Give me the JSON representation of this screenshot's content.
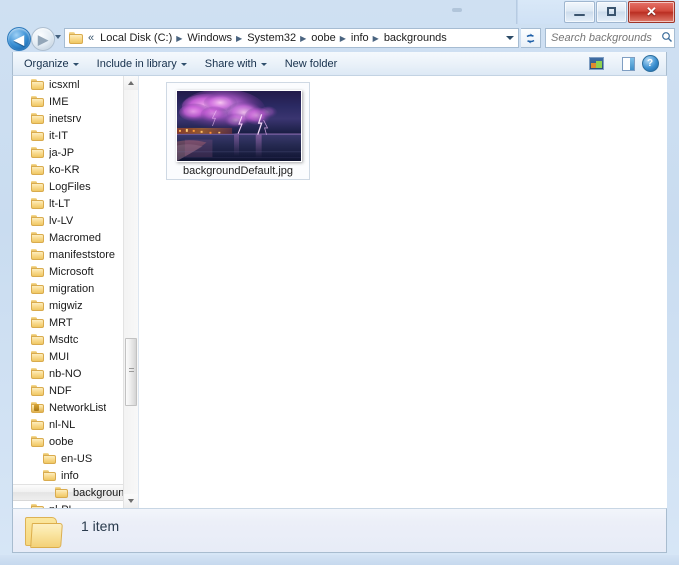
{
  "window": {
    "title": "",
    "buttons": {
      "minimize": "minimize-button",
      "maximize": "maximize-button",
      "close_glyph": "✕"
    }
  },
  "navigation": {
    "back_label": "◀",
    "forward_label": "▶",
    "recent_pages_label": "Recent pages",
    "address_ellipsis": "«",
    "breadcrumbs": [
      {
        "label": "Local Disk (C:)"
      },
      {
        "label": "Windows"
      },
      {
        "label": "System32"
      },
      {
        "label": "oobe"
      },
      {
        "label": "info"
      },
      {
        "label": "backgrounds"
      }
    ],
    "separator": "▶",
    "refresh_label": "↻",
    "search": {
      "placeholder": "Search backgrounds",
      "value": "",
      "icon": "search-icon"
    }
  },
  "toolbar": {
    "items": [
      {
        "label": "Organize",
        "has_caret": true
      },
      {
        "label": "Include in library",
        "has_caret": true
      },
      {
        "label": "Share with",
        "has_caret": true
      },
      {
        "label": "New folder",
        "has_caret": false
      }
    ],
    "right_icons": [
      {
        "name": "change-view-icon",
        "has_caret": true
      },
      {
        "name": "preview-pane-icon",
        "has_caret": false
      },
      {
        "name": "help-icon",
        "glyph": "?",
        "has_caret": false
      }
    ]
  },
  "sidebar": {
    "scrollbar": {
      "up_arrow": "scroll-up-arrow",
      "down_arrow": "scroll-down-arrow",
      "thumb": "scrollbar-thumb"
    },
    "items": [
      {
        "label": "icsxml",
        "indent": 0,
        "selected": false,
        "locked": false
      },
      {
        "label": "IME",
        "indent": 0,
        "selected": false,
        "locked": false
      },
      {
        "label": "inetsrv",
        "indent": 0,
        "selected": false,
        "locked": false
      },
      {
        "label": "it-IT",
        "indent": 0,
        "selected": false,
        "locked": false
      },
      {
        "label": "ja-JP",
        "indent": 0,
        "selected": false,
        "locked": false
      },
      {
        "label": "ko-KR",
        "indent": 0,
        "selected": false,
        "locked": false
      },
      {
        "label": "LogFiles",
        "indent": 0,
        "selected": false,
        "locked": false
      },
      {
        "label": "lt-LT",
        "indent": 0,
        "selected": false,
        "locked": false
      },
      {
        "label": "lv-LV",
        "indent": 0,
        "selected": false,
        "locked": false
      },
      {
        "label": "Macromed",
        "indent": 0,
        "selected": false,
        "locked": false
      },
      {
        "label": "manifeststore",
        "indent": 0,
        "selected": false,
        "locked": false
      },
      {
        "label": "Microsoft",
        "indent": 0,
        "selected": false,
        "locked": false
      },
      {
        "label": "migration",
        "indent": 0,
        "selected": false,
        "locked": false
      },
      {
        "label": "migwiz",
        "indent": 0,
        "selected": false,
        "locked": false
      },
      {
        "label": "MRT",
        "indent": 0,
        "selected": false,
        "locked": false
      },
      {
        "label": "Msdtc",
        "indent": 0,
        "selected": false,
        "locked": false
      },
      {
        "label": "MUI",
        "indent": 0,
        "selected": false,
        "locked": false
      },
      {
        "label": "nb-NO",
        "indent": 0,
        "selected": false,
        "locked": false
      },
      {
        "label": "NDF",
        "indent": 0,
        "selected": false,
        "locked": false
      },
      {
        "label": "NetworkList",
        "indent": 0,
        "selected": false,
        "locked": true
      },
      {
        "label": "nl-NL",
        "indent": 0,
        "selected": false,
        "locked": false
      },
      {
        "label": "oobe",
        "indent": 0,
        "selected": false,
        "locked": false
      },
      {
        "label": "en-US",
        "indent": 1,
        "selected": false,
        "locked": false
      },
      {
        "label": "info",
        "indent": 1,
        "selected": false,
        "locked": false
      },
      {
        "label": "backgrounds",
        "indent": 2,
        "selected": true,
        "locked": false
      },
      {
        "label": "pl-PL",
        "indent": 0,
        "selected": false,
        "locked": false
      }
    ]
  },
  "content": {
    "files": [
      {
        "name": "backgroundDefault.jpg",
        "thumbnail": "lightning-storm-over-beach-photo",
        "selected": false
      }
    ]
  },
  "status": {
    "icon": "folder-icon",
    "text": "1 item"
  },
  "colors": {
    "accent": "#3d92d6",
    "close_button": "#ba2e22",
    "frame_glass": "#cfe0f2",
    "folder_yellow": "#f3d177",
    "selection": "#e4e4e4"
  }
}
